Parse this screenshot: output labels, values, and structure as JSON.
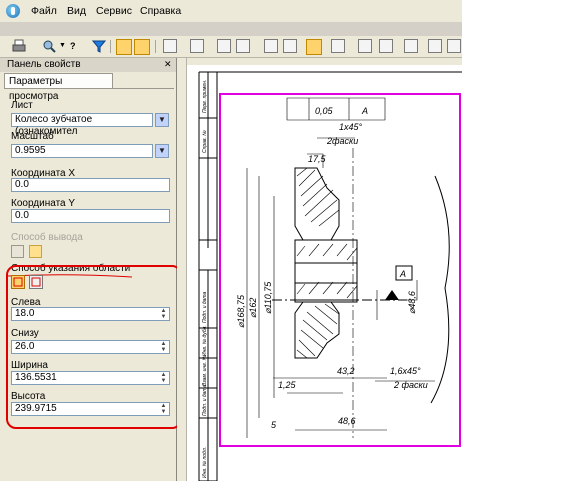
{
  "menu": {
    "items": [
      {
        "label": "Файл"
      },
      {
        "label": "Вид"
      },
      {
        "label": "Сервис"
      },
      {
        "label": "Справка"
      }
    ]
  },
  "panel": {
    "title": "Панель свойств",
    "tab": "Параметры просмотра",
    "sheet": {
      "label": "Лист",
      "value": "Колесо зубчатое (ознакомител"
    },
    "scale": {
      "label": "Масштаб",
      "value": "0.9595"
    },
    "coord_x": {
      "label": "Координата X",
      "value": "0.0"
    },
    "coord_y": {
      "label": "Координата Y",
      "value": "0.0"
    },
    "output_mode": {
      "label": "Способ вывода"
    },
    "area_mode": {
      "label": "Способ указания области"
    },
    "left": {
      "label": "Слева",
      "value": "18.0"
    },
    "bottom": {
      "label": "Снизу",
      "value": "26.0"
    },
    "width": {
      "label": "Ширина",
      "value": "136.5531"
    },
    "height": {
      "label": "Высота",
      "value": "239.9715"
    }
  },
  "drawing": {
    "tol_value": "0,05",
    "tol_datum": "A",
    "chamfer_top": "1x45°",
    "chamfer_top_note": "2фаски",
    "dim_175": "17,5",
    "dim_d1": "⌀168,75",
    "dim_d2": "⌀162",
    "dim_d3": "⌀110,75",
    "dim_d4": "⌀48,6",
    "datum_a": "A",
    "dim_125": "1,25",
    "dim_432": "43,2",
    "chamfer_bottom": "1,6x45°",
    "chamfer_bottom_note": "2 фаски",
    "dim_486": "48,6",
    "dim_5": "5",
    "stamp": [
      "Перв. примен.",
      "Справ. №",
      "Подп. и дата",
      "Инв. № дубл.",
      "Взам. инв. №",
      "Подп. и дата",
      "Инв. № подл."
    ]
  },
  "colors": {
    "highlight_frame": "#e00000",
    "sheet_frame": "#e000e0"
  }
}
